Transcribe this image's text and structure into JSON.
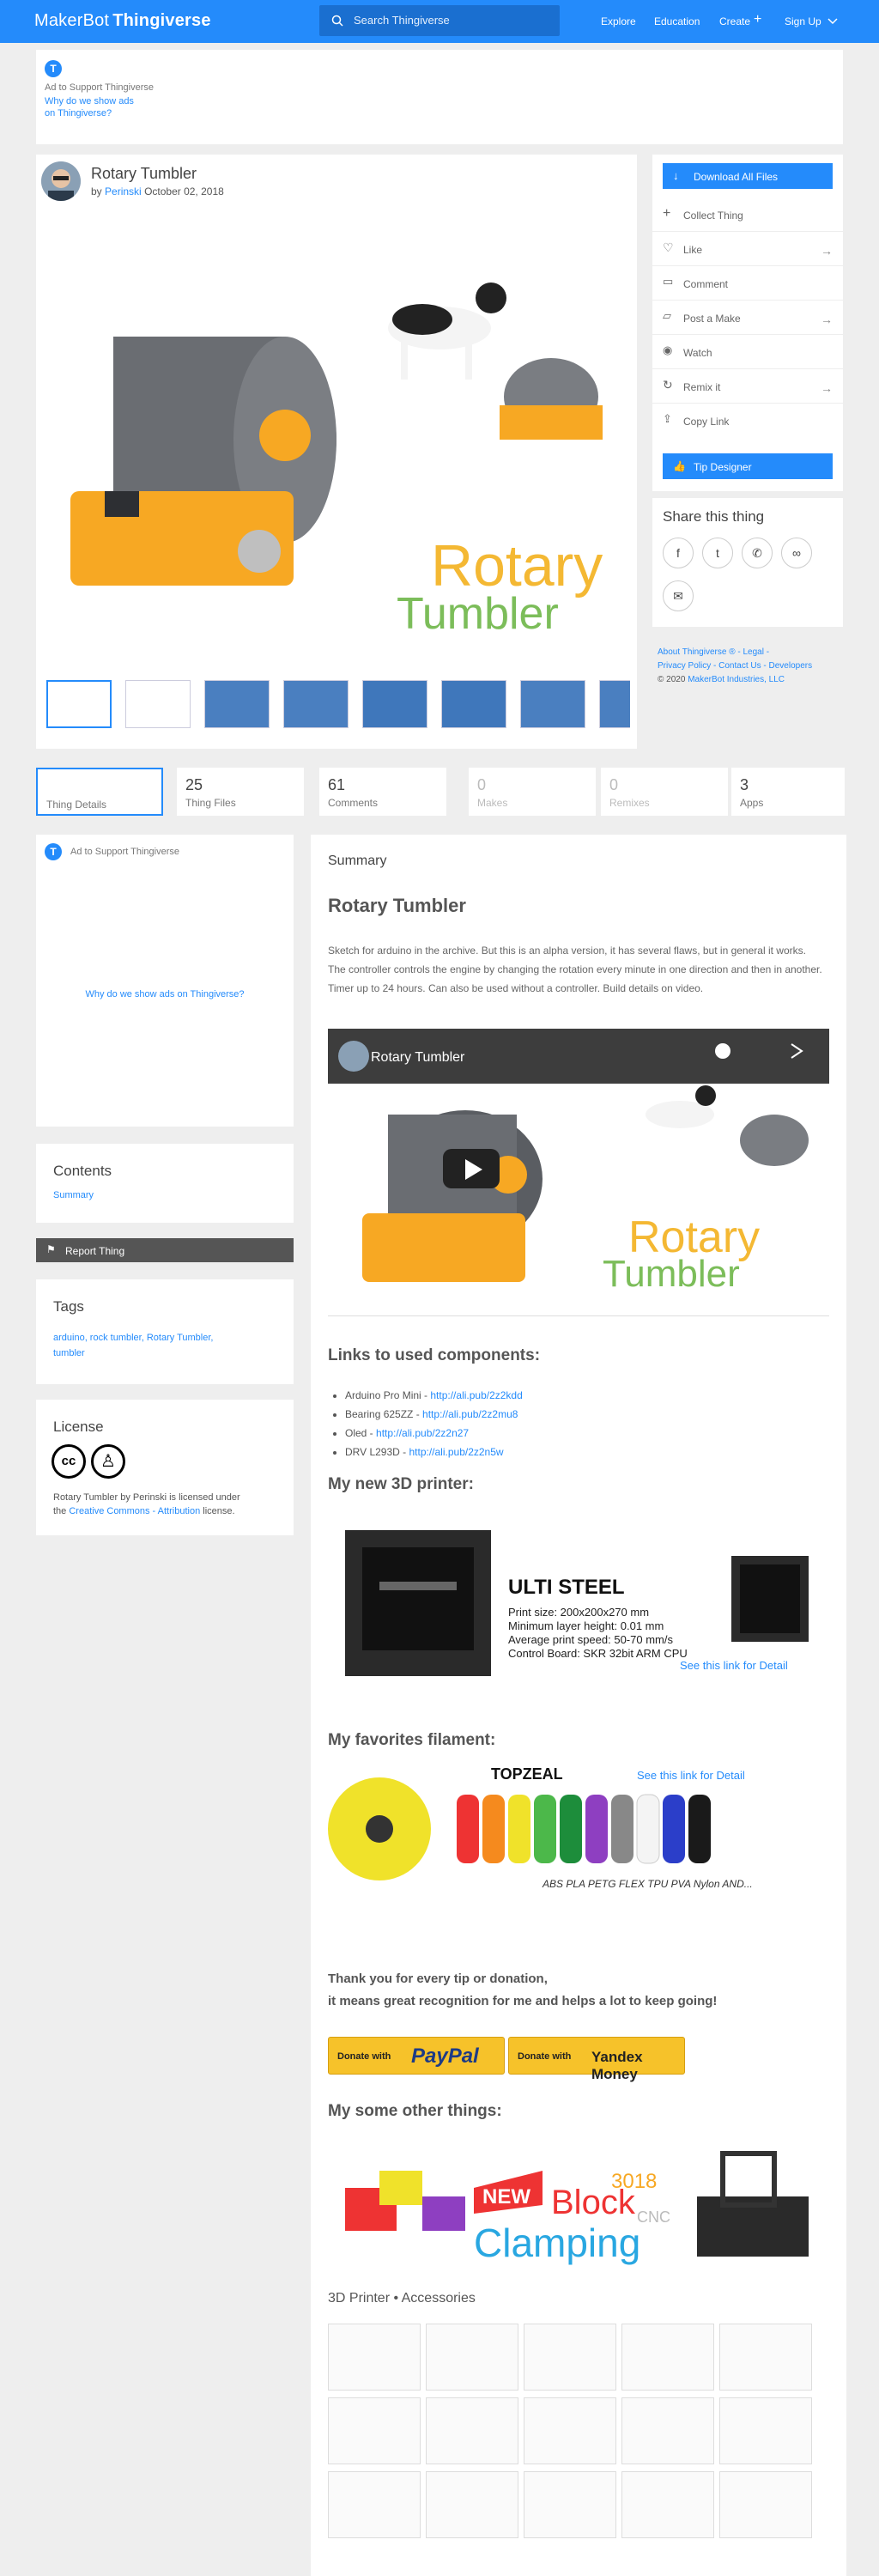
{
  "header": {
    "logo_brand": "MakerBot",
    "logo_name": "Thingiverse",
    "search_placeholder": "Search Thingiverse",
    "nav": [
      "Explore",
      "Education",
      "Create",
      "Sign Up"
    ]
  },
  "top_ad": {
    "label": "Ad to Support Thingiverse",
    "why_line1": "Why do we show ads",
    "why_line2": "on Thingiverse?"
  },
  "thing": {
    "title": "Rotary Tumbler",
    "by": "by",
    "author": "Perinski",
    "date": "October 02, 2018",
    "hero_text_1": "Rotary",
    "hero_text_2": "Tumbler"
  },
  "actions": {
    "download": "Download All Files",
    "collect": "Collect Thing",
    "like": "Like",
    "comment": "Comment",
    "post_make": "Post a Make",
    "watch": "Watch",
    "remix": "Remix it",
    "copy_link": "Copy Link",
    "tip": "Tip Designer"
  },
  "share": {
    "title": "Share this thing"
  },
  "footer_links": {
    "about": "About Thingiverse ®",
    "legal": "Legal",
    "privacy": "Privacy Policy",
    "contact": "Contact Us",
    "developers": "Developers",
    "copyright": "© 2020",
    "company": "MakerBot Industries, LLC"
  },
  "stats": [
    {
      "num": "",
      "label": "Thing Details"
    },
    {
      "num": "25",
      "label": "Thing Files"
    },
    {
      "num": "61",
      "label": "Comments"
    },
    {
      "num": "0",
      "label": "Makes"
    },
    {
      "num": "0",
      "label": "Remixes"
    },
    {
      "num": "3",
      "label": "Apps"
    }
  ],
  "left_ad": {
    "label": "Ad to Support Thingiverse",
    "why": "Why do we show ads on Thingiverse?"
  },
  "contents": {
    "title": "Contents",
    "item": "Summary"
  },
  "report": "Report Thing",
  "tags": {
    "title": "Tags",
    "line1": "arduino, rock tumbler, Rotary Tumbler,",
    "line2": "tumbler"
  },
  "license": {
    "title": "License",
    "text_1": "Rotary Tumbler by Perinski is licensed under",
    "text_2": "the",
    "link": "Creative Commons - Attribution",
    "text_3": "license."
  },
  "summary": {
    "section": "Summary",
    "heading": "Rotary Tumbler",
    "description": "Sketch for arduino in the archive. But this is an alpha version, it has several flaws, but in general it works. The controller controls the engine by changing the rotation every minute in one direction and then in another. Timer up to 24 hours. Can also be used without a controller. Build details on video.",
    "video_title": "Rotary Tumbler",
    "links_heading": "Links to used components:",
    "components": [
      {
        "name": "Arduino Pro Mini - ",
        "url": "http://ali.pub/2z2kdd"
      },
      {
        "name": "Bearing 625ZZ - ",
        "url": "http://ali.pub/2z2mu8"
      },
      {
        "name": "Oled - ",
        "url": "http://ali.pub/2z2n27"
      },
      {
        "name": "DRV L293D - ",
        "url": "http://ali.pub/2z2n5w"
      }
    ],
    "printer_heading": "My new 3D printer:",
    "printer": {
      "brand": "ULTI STEEL",
      "spec1": "Print size: 200x200x270 mm",
      "spec2": "Minimum layer height: 0.01 mm",
      "spec3": "Average print speed: 50-70 mm/s",
      "spec4": "Control Board: SKR 32bit ARM CPU",
      "link": "See this link for Detail"
    },
    "filament_heading": "My favorites filament:",
    "filament": {
      "brand": "TOPZEAL",
      "link": "See this link for Detail",
      "types": "ABS PLA PETG FLEX TPU PVA Nylon AND..."
    },
    "thanks_1": "Thank you for every tip or donation,",
    "thanks_2": "it means great recognition for me and helps a lot to keep going!",
    "donate_small": "Donate with",
    "paypal": "PayPal",
    "yandex": "Yandex Money",
    "other_heading": "My some other things:",
    "other_words": [
      "NEW",
      "Block",
      "Clamping",
      "3018",
      "CNC"
    ],
    "category": "3D Printer • Accessories"
  },
  "colors": {
    "brand_blue": "#248bfb",
    "bg": "#eeeeee",
    "orange": "#f7a823",
    "green": "#7cbd5a"
  }
}
